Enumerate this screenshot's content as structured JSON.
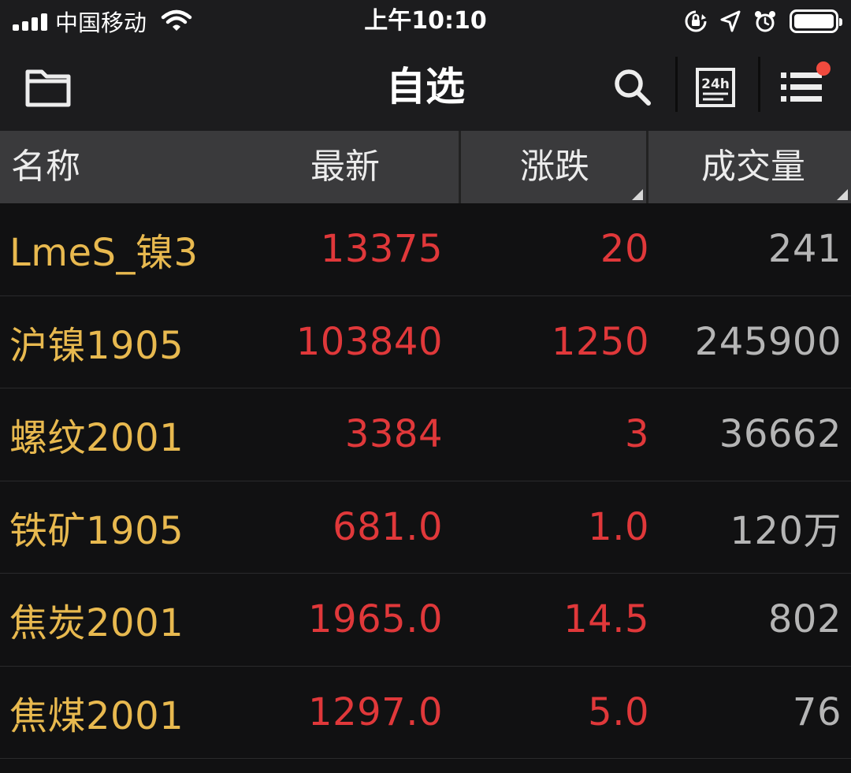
{
  "status_bar": {
    "carrier": "中国移动",
    "time": "上午10:10",
    "icons": [
      "signal-bars-icon",
      "wifi-icon",
      "orientation-lock-icon",
      "location-arrow-icon",
      "alarm-icon",
      "battery-icon"
    ]
  },
  "nav": {
    "title": "自选",
    "left_icon": "folder-icon",
    "right_icons": [
      "search-icon",
      "24h-icon",
      "menu-list-icon"
    ],
    "notification_dot_color": "#f04a3e",
    "badge_24h": "24h"
  },
  "table": {
    "headers": {
      "name": "名称",
      "latest": "最新",
      "change": "涨跌",
      "volume": "成交量"
    },
    "rows": [
      {
        "name": "LmeS_镍3",
        "latest": "13375",
        "change": "20",
        "volume": "241"
      },
      {
        "name": "沪镍1905",
        "latest": "103840",
        "change": "1250",
        "volume": "245900"
      },
      {
        "name": "螺纹2001",
        "latest": "3384",
        "change": "3",
        "volume": "36662"
      },
      {
        "name": "铁矿1905",
        "latest": "681.0",
        "change": "1.0",
        "volume": "120万"
      },
      {
        "name": "焦炭2001",
        "latest": "1965.0",
        "change": "14.5",
        "volume": "802"
      },
      {
        "name": "焦煤2001",
        "latest": "1297.0",
        "change": "5.0",
        "volume": "76"
      }
    ]
  },
  "colors": {
    "name_text": "#e8b94f",
    "up_text": "#e0383a",
    "volume_text": "#b5b5b5",
    "header_bg": "#3a3a3c",
    "bar_bg": "#1c1c1e"
  }
}
